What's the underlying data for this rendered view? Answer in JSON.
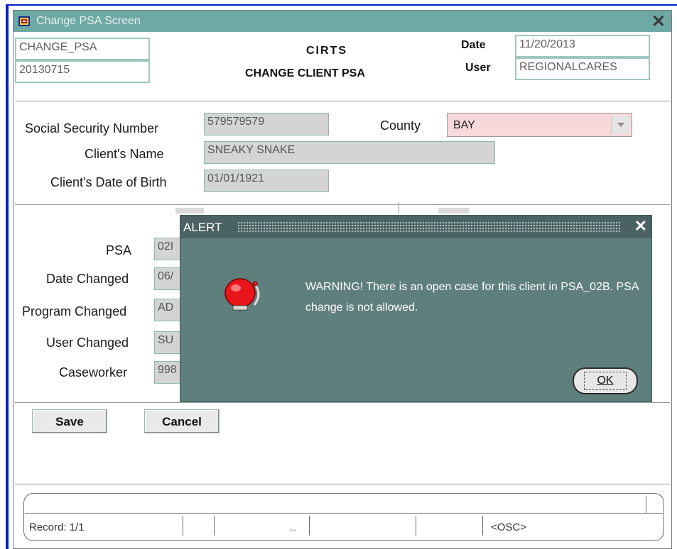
{
  "window": {
    "title": "Change PSA Screen"
  },
  "header": {
    "form_name": "CHANGE_PSA",
    "form_version": "20130715",
    "app_name": "CIRTS",
    "screen_title": "CHANGE CLIENT PSA",
    "date_label": "Date",
    "date_value": "11/20/2013",
    "user_label": "User",
    "user_value": "REGIONALCARES"
  },
  "client": {
    "ssn_label": "Social Security Number",
    "ssn_value": "579579579",
    "county_label": "County",
    "county_value": "BAY",
    "name_label": "Client's Name",
    "name_value": "SNEAKY SNAKE",
    "dob_label": "Client's Date of Birth",
    "dob_value": "01/01/1921"
  },
  "psa": {
    "psa_label": "PSA",
    "psa_value": "02I",
    "date_changed_label": "Date Changed",
    "date_changed_value": "06/",
    "program_changed_label": "Program Changed",
    "program_changed_value": "AD",
    "user_changed_label": "User Changed",
    "user_changed_value": "SU",
    "caseworker_label": "Caseworker",
    "caseworker_value": "998"
  },
  "buttons": {
    "save": "Save",
    "cancel": "Cancel"
  },
  "status_bar": {
    "record": "Record: 1/1",
    "ellipsis": "...",
    "osc": "<OSC>"
  },
  "alert": {
    "title": "ALERT",
    "message": "WARNING!  There is an open case for this client in PSA_02B.  PSA change is not allowed.",
    "ok_label": "OK"
  },
  "colors": {
    "titlebar": "#6fa9a6",
    "alert_bg": "#5f7f7d",
    "county_bg": "#f8d8da",
    "field_border": "#9fc7c0"
  },
  "icons": [
    "app-icon",
    "close-icon",
    "bell-icon",
    "dropdown-arrow-icon"
  ]
}
